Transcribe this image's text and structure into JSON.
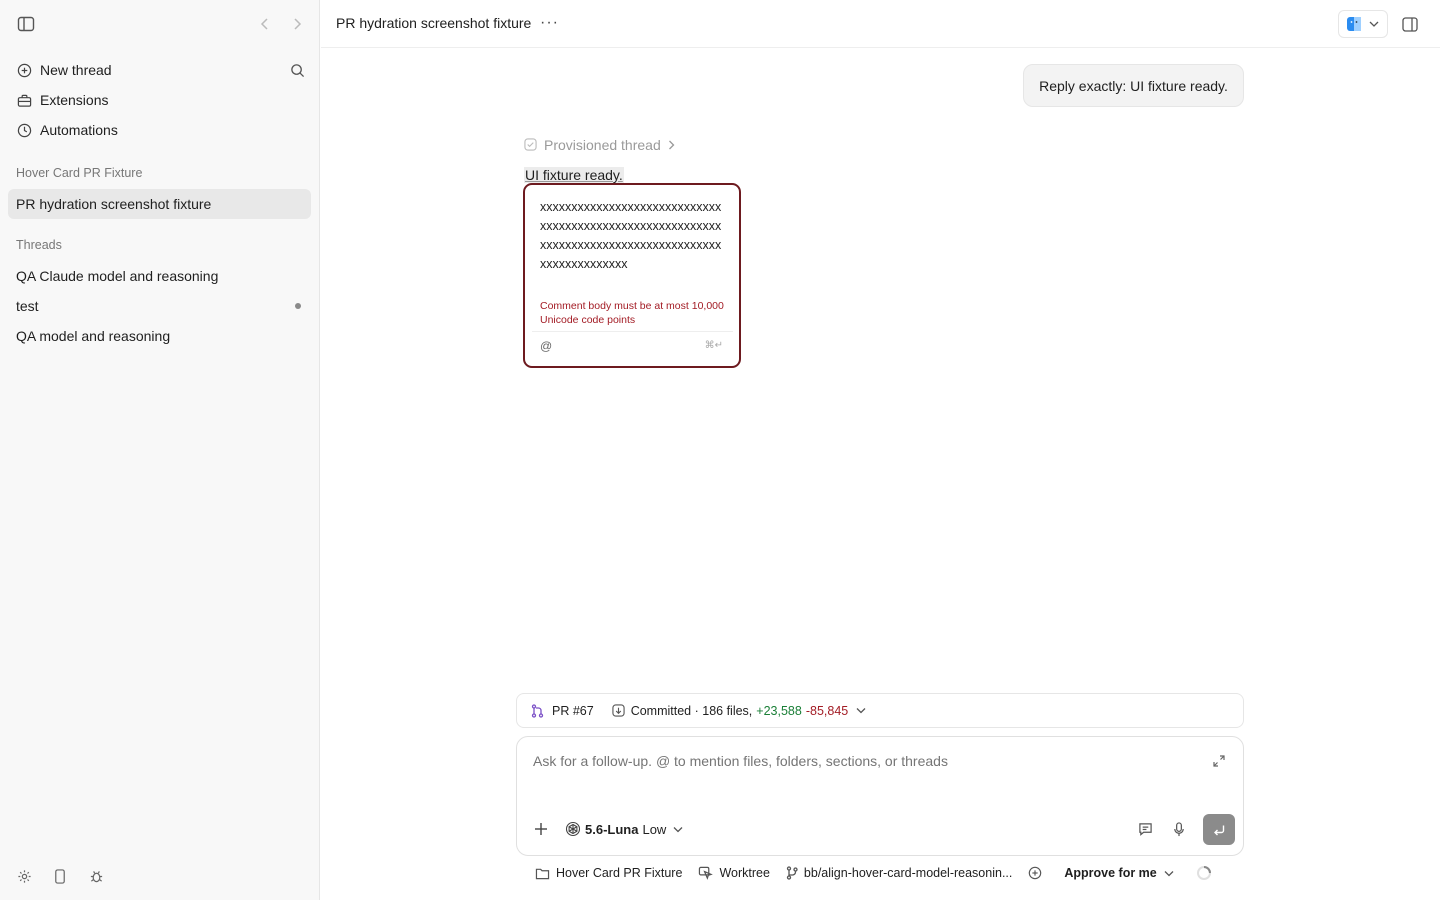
{
  "sidebar": {
    "nav": [
      {
        "label": "New thread",
        "icon": "plus-circle-icon"
      },
      {
        "label": "Extensions",
        "icon": "toolbox-icon"
      },
      {
        "label": "Automations",
        "icon": "clock-icon"
      }
    ],
    "project_section": "Hover Card PR Fixture",
    "project_threads": [
      {
        "label": "PR hydration screenshot fixture",
        "active": true
      }
    ],
    "threads_section": "Threads",
    "threads": [
      {
        "label": "QA Claude model and reasoning"
      },
      {
        "label": "test",
        "unread": true
      },
      {
        "label": "QA model and reasoning"
      }
    ]
  },
  "topbar": {
    "title": "PR hydration screenshot fixture",
    "more": "···"
  },
  "conversation": {
    "user_message": "Reply exactly: UI fixture ready.",
    "provisioned_label": "Provisioned thread",
    "assistant_text": "UI fixture ready."
  },
  "comment": {
    "body": "xxxxxxxxxxxxxxxxxxxxxxxxxxxxxxxxxxxxxxxxxxxxxxxxxxxxxxxxxxxxxxxxxxxxxxxxxxxxxxxxxxxxxxxxxxxxxxxxxxxxx",
    "error": "Comment body must be at most 10,000 Unicode code points",
    "mention_symbol": "@",
    "send_hint": "⌘↵"
  },
  "pr": {
    "label": "PR #67",
    "status": "Committed · 186 files,",
    "additions": "+23,588",
    "deletions": "-85,845"
  },
  "composer": {
    "placeholder": "Ask for a follow-up. @ to mention files, folders, sections, or threads",
    "model": "5.6-Luna",
    "effort": "Low"
  },
  "footer": {
    "folder": "Hover Card PR Fixture",
    "worktree": "Worktree",
    "branch": "bb/align-hover-card-model-reasonin...",
    "approval": "Approve for me"
  },
  "colors": {
    "accent_error": "#6d1a1f",
    "additions": "#1a7f37",
    "deletions": "#a31c25"
  }
}
